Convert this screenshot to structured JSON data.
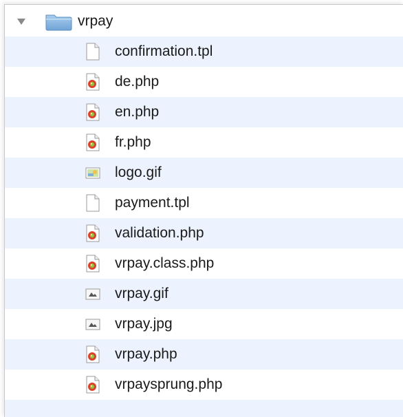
{
  "folder": {
    "name": "vrpay",
    "icon": "folder-icon",
    "expanded": true
  },
  "files": [
    {
      "name": "confirmation.tpl",
      "icon": "text-document-icon"
    },
    {
      "name": "de.php",
      "icon": "php-file-icon"
    },
    {
      "name": "en.php",
      "icon": "php-file-icon"
    },
    {
      "name": "fr.php",
      "icon": "php-file-icon"
    },
    {
      "name": "logo.gif",
      "icon": "image-thumbnail-icon"
    },
    {
      "name": "payment.tpl",
      "icon": "text-document-icon"
    },
    {
      "name": "validation.php",
      "icon": "php-file-icon"
    },
    {
      "name": "vrpay.class.php",
      "icon": "php-file-icon"
    },
    {
      "name": "vrpay.gif",
      "icon": "image-preview-icon"
    },
    {
      "name": "vrpay.jpg",
      "icon": "image-preview-icon"
    },
    {
      "name": "vrpay.php",
      "icon": "php-file-icon"
    },
    {
      "name": "vrpaysprung.php",
      "icon": "php-file-icon"
    }
  ],
  "colors": {
    "stripe": "#edf3fe",
    "folder": "#7fb3e0",
    "php_badge": "#d9432a"
  }
}
